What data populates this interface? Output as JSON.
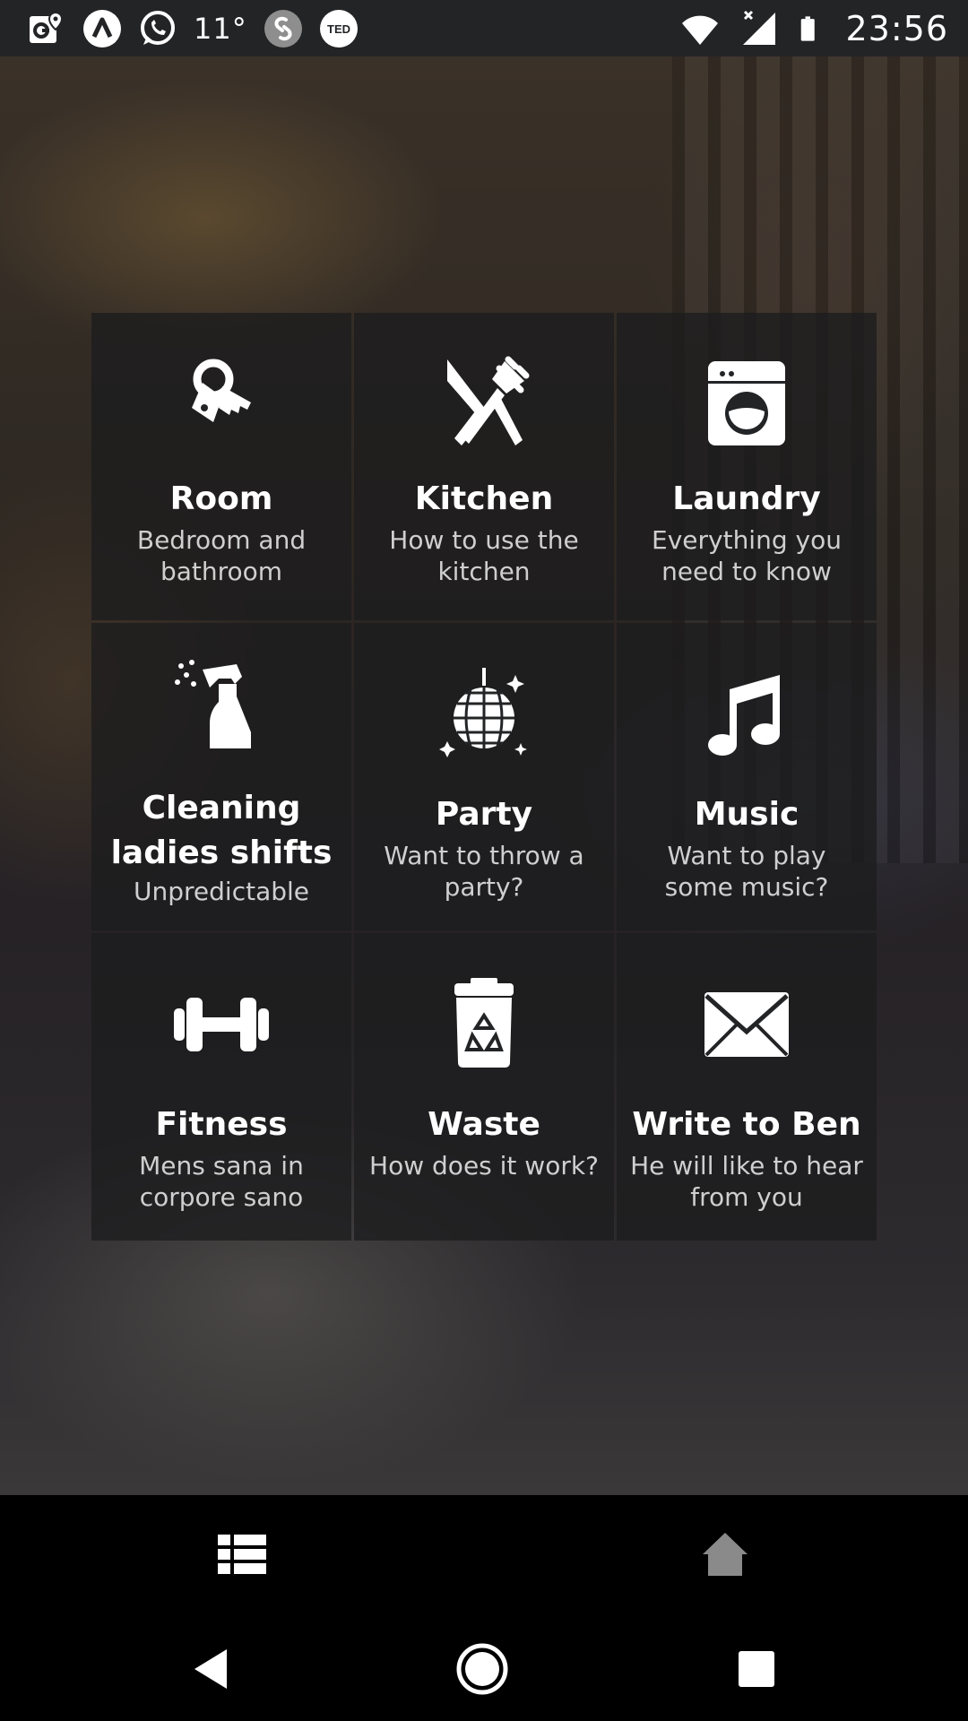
{
  "status_bar": {
    "left_icons": [
      "maps-icon",
      "app-a-icon",
      "whatsapp-icon",
      "weather-temp",
      "shazam-icon",
      "ted-icon"
    ],
    "temperature": "11°",
    "ted_label": "TED",
    "right_icons": [
      "wifi-icon",
      "signal-icon",
      "battery-icon"
    ],
    "time": "23:56"
  },
  "tiles": [
    {
      "title": "Room",
      "subtitle": "Bedroom and bathroom",
      "icon": "keys-icon"
    },
    {
      "title": "Kitchen",
      "subtitle": "How to use the kitchen",
      "icon": "cutlery-icon"
    },
    {
      "title": "Laundry",
      "subtitle": "Everything you need to know",
      "icon": "washing-machine-icon"
    },
    {
      "title": "Cleaning ladies shifts",
      "subtitle": "Unpredictable",
      "icon": "spray-bottle-icon"
    },
    {
      "title": "Party",
      "subtitle": "Want to throw a party?",
      "icon": "disco-ball-icon"
    },
    {
      "title": "Music",
      "subtitle": "Want to play some music?",
      "icon": "music-note-icon"
    },
    {
      "title": "Fitness",
      "subtitle": "Mens sana in corpore sano",
      "icon": "dumbbell-icon"
    },
    {
      "title": "Waste",
      "subtitle": "How does it work?",
      "icon": "recycle-bin-icon"
    },
    {
      "title": "Write to Ben",
      "subtitle": "He will like to hear from you",
      "icon": "envelope-icon"
    }
  ],
  "bottom_bar": {
    "buttons": [
      "list-icon",
      "home-icon"
    ],
    "home_color": "#8a8a8a"
  },
  "nav_bar": {
    "buttons": [
      "back-icon",
      "home-circle-icon",
      "recents-icon"
    ]
  }
}
